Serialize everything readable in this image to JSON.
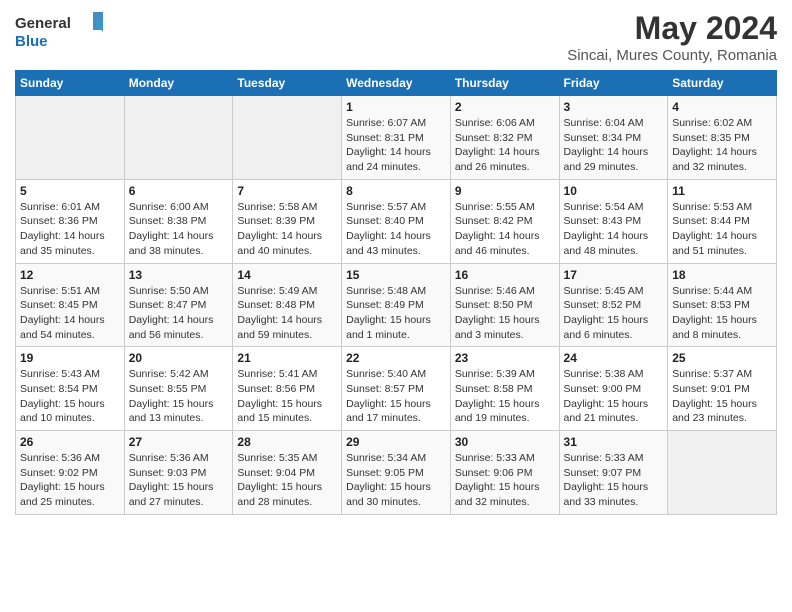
{
  "header": {
    "logo_general": "General",
    "logo_blue": "Blue",
    "title": "May 2024",
    "subtitle": "Sincai, Mures County, Romania"
  },
  "days_of_week": [
    "Sunday",
    "Monday",
    "Tuesday",
    "Wednesday",
    "Thursday",
    "Friday",
    "Saturday"
  ],
  "weeks": [
    [
      {
        "day": "",
        "info": ""
      },
      {
        "day": "",
        "info": ""
      },
      {
        "day": "",
        "info": ""
      },
      {
        "day": "1",
        "info": "Sunrise: 6:07 AM\nSunset: 8:31 PM\nDaylight: 14 hours\nand 24 minutes."
      },
      {
        "day": "2",
        "info": "Sunrise: 6:06 AM\nSunset: 8:32 PM\nDaylight: 14 hours\nand 26 minutes."
      },
      {
        "day": "3",
        "info": "Sunrise: 6:04 AM\nSunset: 8:34 PM\nDaylight: 14 hours\nand 29 minutes."
      },
      {
        "day": "4",
        "info": "Sunrise: 6:02 AM\nSunset: 8:35 PM\nDaylight: 14 hours\nand 32 minutes."
      }
    ],
    [
      {
        "day": "5",
        "info": "Sunrise: 6:01 AM\nSunset: 8:36 PM\nDaylight: 14 hours\nand 35 minutes."
      },
      {
        "day": "6",
        "info": "Sunrise: 6:00 AM\nSunset: 8:38 PM\nDaylight: 14 hours\nand 38 minutes."
      },
      {
        "day": "7",
        "info": "Sunrise: 5:58 AM\nSunset: 8:39 PM\nDaylight: 14 hours\nand 40 minutes."
      },
      {
        "day": "8",
        "info": "Sunrise: 5:57 AM\nSunset: 8:40 PM\nDaylight: 14 hours\nand 43 minutes."
      },
      {
        "day": "9",
        "info": "Sunrise: 5:55 AM\nSunset: 8:42 PM\nDaylight: 14 hours\nand 46 minutes."
      },
      {
        "day": "10",
        "info": "Sunrise: 5:54 AM\nSunset: 8:43 PM\nDaylight: 14 hours\nand 48 minutes."
      },
      {
        "day": "11",
        "info": "Sunrise: 5:53 AM\nSunset: 8:44 PM\nDaylight: 14 hours\nand 51 minutes."
      }
    ],
    [
      {
        "day": "12",
        "info": "Sunrise: 5:51 AM\nSunset: 8:45 PM\nDaylight: 14 hours\nand 54 minutes."
      },
      {
        "day": "13",
        "info": "Sunrise: 5:50 AM\nSunset: 8:47 PM\nDaylight: 14 hours\nand 56 minutes."
      },
      {
        "day": "14",
        "info": "Sunrise: 5:49 AM\nSunset: 8:48 PM\nDaylight: 14 hours\nand 59 minutes."
      },
      {
        "day": "15",
        "info": "Sunrise: 5:48 AM\nSunset: 8:49 PM\nDaylight: 15 hours\nand 1 minute."
      },
      {
        "day": "16",
        "info": "Sunrise: 5:46 AM\nSunset: 8:50 PM\nDaylight: 15 hours\nand 3 minutes."
      },
      {
        "day": "17",
        "info": "Sunrise: 5:45 AM\nSunset: 8:52 PM\nDaylight: 15 hours\nand 6 minutes."
      },
      {
        "day": "18",
        "info": "Sunrise: 5:44 AM\nSunset: 8:53 PM\nDaylight: 15 hours\nand 8 minutes."
      }
    ],
    [
      {
        "day": "19",
        "info": "Sunrise: 5:43 AM\nSunset: 8:54 PM\nDaylight: 15 hours\nand 10 minutes."
      },
      {
        "day": "20",
        "info": "Sunrise: 5:42 AM\nSunset: 8:55 PM\nDaylight: 15 hours\nand 13 minutes."
      },
      {
        "day": "21",
        "info": "Sunrise: 5:41 AM\nSunset: 8:56 PM\nDaylight: 15 hours\nand 15 minutes."
      },
      {
        "day": "22",
        "info": "Sunrise: 5:40 AM\nSunset: 8:57 PM\nDaylight: 15 hours\nand 17 minutes."
      },
      {
        "day": "23",
        "info": "Sunrise: 5:39 AM\nSunset: 8:58 PM\nDaylight: 15 hours\nand 19 minutes."
      },
      {
        "day": "24",
        "info": "Sunrise: 5:38 AM\nSunset: 9:00 PM\nDaylight: 15 hours\nand 21 minutes."
      },
      {
        "day": "25",
        "info": "Sunrise: 5:37 AM\nSunset: 9:01 PM\nDaylight: 15 hours\nand 23 minutes."
      }
    ],
    [
      {
        "day": "26",
        "info": "Sunrise: 5:36 AM\nSunset: 9:02 PM\nDaylight: 15 hours\nand 25 minutes."
      },
      {
        "day": "27",
        "info": "Sunrise: 5:36 AM\nSunset: 9:03 PM\nDaylight: 15 hours\nand 27 minutes."
      },
      {
        "day": "28",
        "info": "Sunrise: 5:35 AM\nSunset: 9:04 PM\nDaylight: 15 hours\nand 28 minutes."
      },
      {
        "day": "29",
        "info": "Sunrise: 5:34 AM\nSunset: 9:05 PM\nDaylight: 15 hours\nand 30 minutes."
      },
      {
        "day": "30",
        "info": "Sunrise: 5:33 AM\nSunset: 9:06 PM\nDaylight: 15 hours\nand 32 minutes."
      },
      {
        "day": "31",
        "info": "Sunrise: 5:33 AM\nSunset: 9:07 PM\nDaylight: 15 hours\nand 33 minutes."
      },
      {
        "day": "",
        "info": ""
      }
    ]
  ]
}
